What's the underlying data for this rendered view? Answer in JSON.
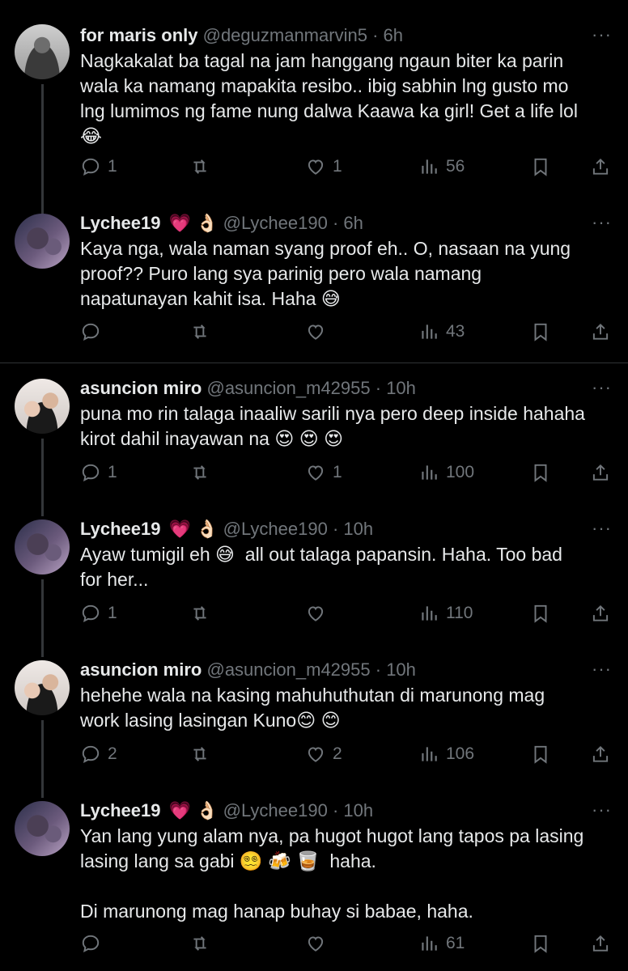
{
  "tweets": [
    {
      "name": "for maris only",
      "name_emojis": "",
      "handle": "@deguzmanmarvin5",
      "time": "· 6h",
      "text": "Nagkakalat ba tagal na jam hanggang ngaun biter ka parin\nwala ka namang mapakita resibo.. ibig sabhin lng gusto mo\nlng lumimos ng fame nung dalwa Kaawa ka girl! Get a life lol\n😂",
      "replies": "1",
      "reposts": "",
      "likes": "1",
      "views": "56"
    },
    {
      "name": "Lychee19",
      "name_emojis": "💗 👌🏻",
      "handle": "@Lychee190",
      "time": "· 6h",
      "text": "Kaya nga, wala naman syang proof eh.. O, nasaan na yung\nproof?? Puro lang sya parinig pero wala namang\nnapatunayan kahit isa. Haha 😅",
      "replies": "",
      "reposts": "",
      "likes": "",
      "views": "43"
    },
    {
      "name": "asuncion miro",
      "name_emojis": "",
      "handle": "@asuncion_m42955",
      "time": "· 10h",
      "text": "puna mo rin talaga inaaliw sarili nya pero deep inside hahaha\nkirot dahil inayawan na 😍 😍 😍",
      "replies": "1",
      "reposts": "",
      "likes": "1",
      "views": "100"
    },
    {
      "name": "Lychee19",
      "name_emojis": "💗 👌🏻",
      "handle": "@Lychee190",
      "time": "· 10h",
      "text": "Ayaw tumigil eh 😅  all out talaga papansin. Haha. Too bad\nfor her...",
      "replies": "1",
      "reposts": "",
      "likes": "",
      "views": "110"
    },
    {
      "name": "asuncion miro",
      "name_emojis": "",
      "handle": "@asuncion_m42955",
      "time": "· 10h",
      "text": "hehehe wala na kasing mahuhuthutan di marunong mag\nwork lasing lasingan Kuno😊 😊",
      "replies": "2",
      "reposts": "",
      "likes": "2",
      "views": "106"
    },
    {
      "name": "Lychee19",
      "name_emojis": "💗 👌🏻",
      "handle": "@Lychee190",
      "time": "· 10h",
      "text": "Yan lang yung alam nya, pa hugot hugot lang tapos pa lasing\nlasing lang sa gabi 😵‍💫 🍻 🥃  haha.\n\nDi marunong mag hanap buhay si babae, haha.",
      "replies": "",
      "reposts": "",
      "likes": "",
      "views": "61"
    }
  ],
  "more_label": "···",
  "colors": {
    "background": "#000000",
    "text": "#e7e9ea",
    "muted": "#71767b",
    "divider": "#2f3336"
  }
}
